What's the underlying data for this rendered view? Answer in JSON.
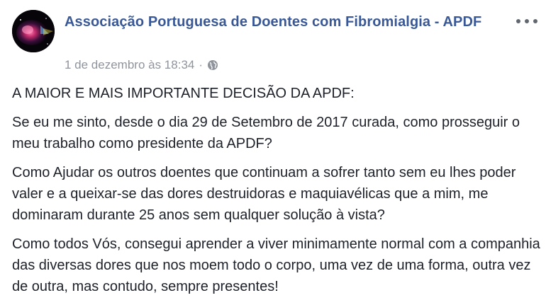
{
  "post": {
    "author": "Associação Portuguesa de Doentes com Fibromialgia - APDF",
    "timestamp": "1 de dezembro às 18:34",
    "separator": "·",
    "privacy_icon": "globe-icon",
    "more_icon": "more-options-icon",
    "paragraphs": [
      "A MAIOR E MAIS IMPORTANTE DECISÃO DA APDF:",
      "Se eu me sinto, desde o dia 29 de Setembro de 2017 curada, como prosseguir o meu trabalho como presidente da APDF?",
      "Como Ajudar os outros doentes que continuam a sofrer tanto sem eu lhes poder valer e a queixar-se das dores destruidoras e maquiavélicas que a mim, me dominaram durante 25 anos sem qualquer solução à vista?",
      "Como todos Vós, consegui aprender a viver minimamente normal com a companhia das diversas dores que nos moem todo o corpo, uma vez de uma forma, outra vez de outra, mas contudo, sempre presentes!"
    ]
  },
  "colors": {
    "author": "#385898",
    "meta": "#90949c",
    "text": "#1d2129"
  }
}
